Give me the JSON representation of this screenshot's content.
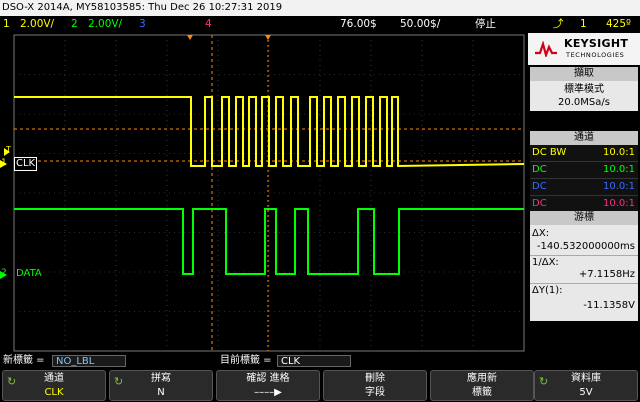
{
  "title_bar": "DSO-X 2014A, MY58103585: Thu Dec 26 10:27:31 2019",
  "status": {
    "ch1_num": "1",
    "ch1_scale": "2.00V/",
    "ch2_num": "2",
    "ch2_scale": "2.00V/",
    "ch3_num": "3",
    "ch4_num": "4",
    "time_position": "76.00$",
    "time_scale": "50.00$/",
    "run_state": "停止",
    "trigger_icon": "trigger-edge-icon",
    "trigger_source": "1",
    "trigger_level": "425º"
  },
  "colors": {
    "ch1": "#ffff00",
    "ch2": "#00ff00",
    "ch3": "#3a6cff",
    "ch4": "#ff2a8a",
    "trigger": "#ff8c00"
  },
  "scope": {
    "ch1_label": "CLK",
    "ch1_marker": "1",
    "ch2_label": "DATA",
    "ch2_marker": "2",
    "trigger_marker": "T"
  },
  "panel": {
    "brand": "KEYSIGHT",
    "brand_sub": "TECHNOLOGIES",
    "acq_head": "擷取",
    "acq_mode": "標準模式",
    "acq_rate": "20.0MSa/s",
    "chan_head": "通道",
    "channels": [
      {
        "coupling": "DC BW",
        "probe": "10.0:1"
      },
      {
        "coupling": "DC",
        "probe": "10.0:1"
      },
      {
        "coupling": "DC",
        "probe": "10.0:1"
      },
      {
        "coupling": "DC",
        "probe": "10.0:1"
      }
    ],
    "cursor_head": "游標",
    "dx_label": "ΔX:",
    "dx_value": "-140.532000000ms",
    "inv_dx_label": "1/ΔX:",
    "inv_dx_value": "+7.1158Hz",
    "dy_label": "ΔY(1):",
    "dy_value": "-11.1358V"
  },
  "label_bar": {
    "new_label": "新標籤 =",
    "new_label_value": "NO_LBL",
    "current_label": "目前標籤 =",
    "current_label_value": "CLK"
  },
  "softkeys": [
    {
      "title": "通道",
      "value": "CLK"
    },
    {
      "title": "拼寫",
      "value": "N"
    },
    {
      "title": "確認  進格",
      "value": ""
    },
    {
      "title": "刪除",
      "value": "字段"
    },
    {
      "title": "應用新",
      "value": "標籤"
    },
    {
      "title": "資料庫",
      "value": "5V"
    }
  ]
}
